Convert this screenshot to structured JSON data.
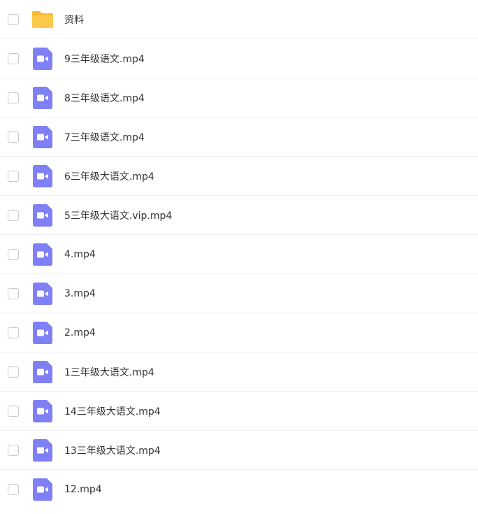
{
  "files": [
    {
      "name": "资料",
      "type": "folder",
      "icon": "folder-icon"
    },
    {
      "name": "9三年级语文.mp4",
      "type": "video",
      "icon": "video-file-icon"
    },
    {
      "name": "8三年级语文.mp4",
      "type": "video",
      "icon": "video-file-icon"
    },
    {
      "name": "7三年级语文.mp4",
      "type": "video",
      "icon": "video-file-icon"
    },
    {
      "name": "6三年级大语文.mp4",
      "type": "video",
      "icon": "video-file-icon"
    },
    {
      "name": "5三年级大语文.vip.mp4",
      "type": "video",
      "icon": "video-file-icon"
    },
    {
      "name": "4.mp4",
      "type": "video",
      "icon": "video-file-icon"
    },
    {
      "name": "3.mp4",
      "type": "video",
      "icon": "video-file-icon"
    },
    {
      "name": "2.mp4",
      "type": "video",
      "icon": "video-file-icon"
    },
    {
      "name": "1三年级大语文.mp4",
      "type": "video",
      "icon": "video-file-icon"
    },
    {
      "name": "14三年级大语文.mp4",
      "type": "video",
      "icon": "video-file-icon"
    },
    {
      "name": "13三年级大语文.mp4",
      "type": "video",
      "icon": "video-file-icon"
    },
    {
      "name": "12.mp4",
      "type": "video",
      "icon": "video-file-icon"
    }
  ],
  "colors": {
    "folder": "#fdc94d",
    "folder_tab": "#f9b936",
    "video": "#7f80f5",
    "text": "#333333",
    "divider": "#f0f0f2",
    "checkbox_border": "#c8cad0"
  }
}
